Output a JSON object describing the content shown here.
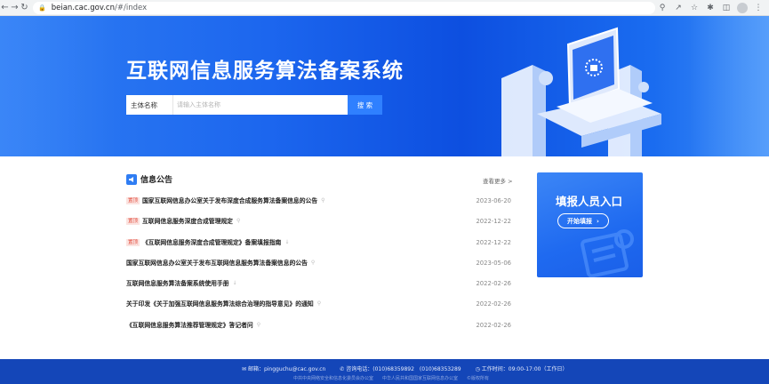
{
  "browser": {
    "url_domain": "beian.cac.gov.cn",
    "url_path": "/#/index"
  },
  "hero": {
    "title": "互联网信息服务算法备案系统",
    "search_label": "主体名称",
    "search_placeholder": "请输入主体名称",
    "search_button": "搜 索"
  },
  "notices": {
    "title": "信息公告",
    "more": "查看更多 >",
    "items": [
      {
        "badge": "置顶",
        "title": "国家互联网信息办公室关于发布深度合成服务算法备案信息的公告",
        "date": "2023-06-20"
      },
      {
        "badge": "置顶",
        "title": "互联网信息服务深度合成管理规定",
        "date": "2022-12-22"
      },
      {
        "badge": "置顶",
        "title": "《互联网信息服务深度合成管理规定》备案填报指南",
        "date": "2022-12-22"
      },
      {
        "badge": "",
        "title": "国家互联网信息办公室关于发布互联网信息服务算法备案信息的公告",
        "date": "2023-05-06"
      },
      {
        "badge": "",
        "title": "互联网信息服务算法备案系统使用手册",
        "date": "2022-02-26"
      },
      {
        "badge": "",
        "title": "关于印发《关于加强互联网信息服务算法综合治理的指导意见》的通知",
        "date": "2022-02-26"
      },
      {
        "badge": "",
        "title": "《互联网信息服务算法推荐管理规定》答记者问",
        "date": "2022-02-26"
      }
    ]
  },
  "report": {
    "title": "填报人员入口",
    "button": "开始填报"
  },
  "footer": {
    "email": "邮箱：pingguchu@cac.gov.cn",
    "phone": "咨询电话：(010)68359892　(010)68353289",
    "hours": "工作时间：09:00-17:00（工作日）",
    "org1": "中共中央网络安全和信息化委员会办公室",
    "org2": "中华人民共和国国家互联网信息办公室",
    "copyright": "版权所有"
  },
  "colors": {
    "primary": "#2f80ff",
    "footer": "#1446b8",
    "badge": "#e24a3b"
  }
}
